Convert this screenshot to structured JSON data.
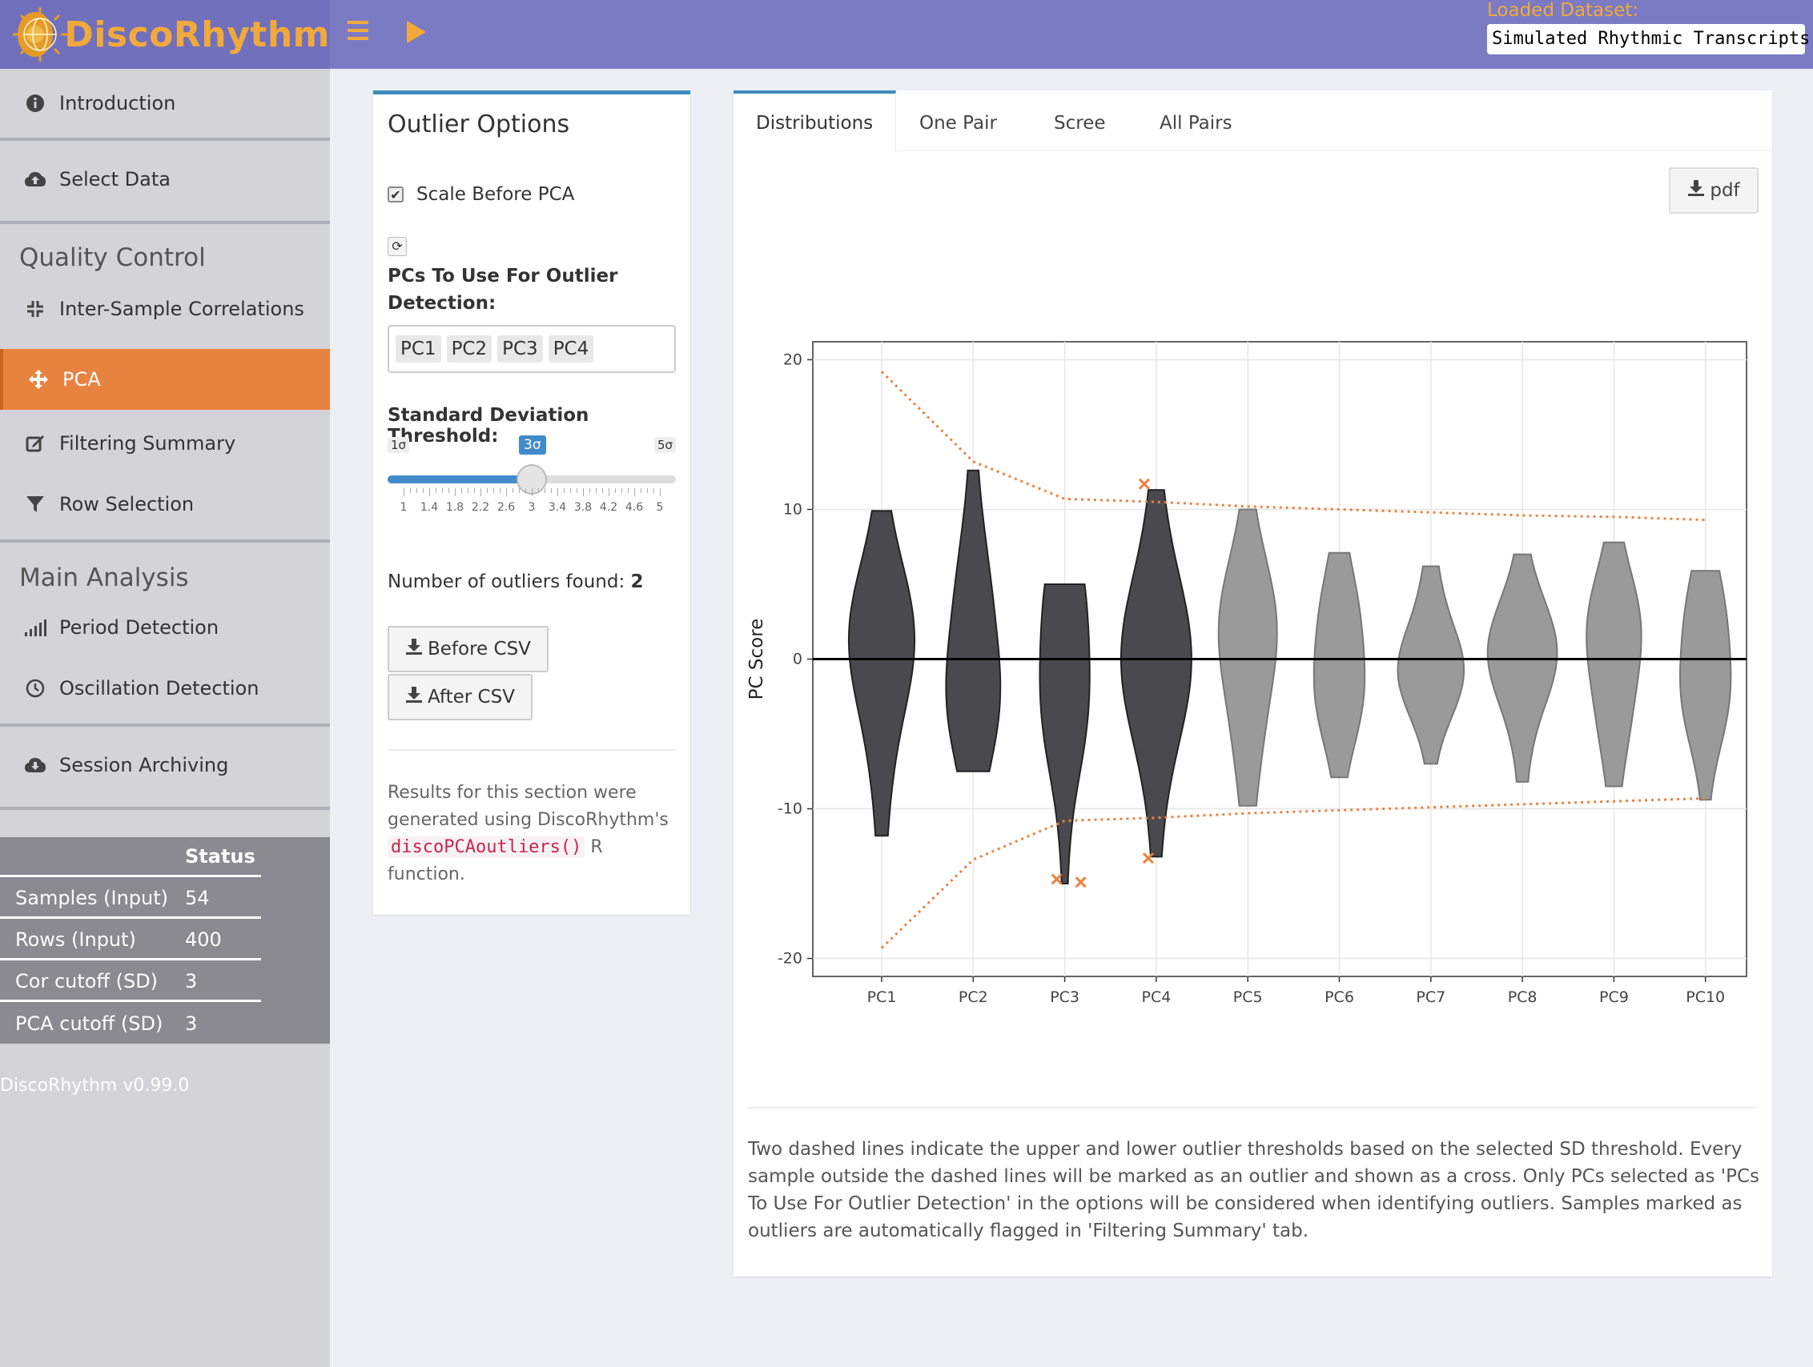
{
  "header": {
    "app_name": "DiscoRhythm",
    "dataset_label": "Loaded Dataset:",
    "dataset_value": "Simulated Rhythmic Transcripts"
  },
  "sidebar": {
    "items": [
      {
        "label": "Introduction",
        "icon": "info-circle-icon"
      },
      {
        "label": "Select Data",
        "icon": "cloud-upload-icon"
      },
      {
        "label": "Inter-Sample Correlations",
        "icon": "compress-icon"
      },
      {
        "label": "PCA",
        "icon": "arrows-move-icon"
      },
      {
        "label": "Filtering Summary",
        "icon": "edit-icon"
      },
      {
        "label": "Row Selection",
        "icon": "filter-icon"
      },
      {
        "label": "Period Detection",
        "icon": "signal-bars-icon"
      },
      {
        "label": "Oscillation Detection",
        "icon": "clock-icon"
      },
      {
        "label": "Session Archiving",
        "icon": "cloud-download-icon"
      }
    ],
    "sections": {
      "quality_control": "Quality Control",
      "main_analysis": "Main Analysis"
    },
    "status_table": {
      "header": "Status",
      "rows": [
        {
          "key": "Samples (Input)",
          "value": "54"
        },
        {
          "key": "Rows (Input)",
          "value": "400"
        },
        {
          "key": "Cor cutoff (SD)",
          "value": "3"
        },
        {
          "key": "PCA cutoff (SD)",
          "value": "3"
        }
      ]
    },
    "version": "DiscoRhythm v0.99.0",
    "active_color": "#e8833f"
  },
  "options": {
    "title": "Outlier Options",
    "scale_label": "Scale Before PCA",
    "scale_checked": true,
    "pcs_label": "PCs To Use For Outlier Detection:",
    "pcs_selected": [
      "PC1",
      "PC2",
      "PC3",
      "PC4"
    ],
    "sd_label": "Standard Deviation Threshold:",
    "sd_min": "1σ",
    "sd_max": "5σ",
    "sd_current": "3σ",
    "sd_value": 3,
    "sd_range": [
      1,
      5
    ],
    "tick_labels": [
      "1",
      "1.4",
      "1.8",
      "2.2",
      "2.6",
      "3",
      "3.4",
      "3.8",
      "4.2",
      "4.6",
      "5"
    ],
    "outliers_label": "Number of outliers found:",
    "outliers_count": "2",
    "before_csv": "Before CSV",
    "after_csv": "After CSV",
    "note_pre": "Results for this section were generated using DiscoRhythm's",
    "note_code": "discoPCAoutliers()",
    "note_post": "R function."
  },
  "plot": {
    "tabs": [
      "Distributions",
      "One Pair",
      "Scree",
      "All Pairs"
    ],
    "active_tab": "Distributions",
    "pdf_label": "pdf",
    "caption": "Two dashed lines indicate the upper and lower outlier thresholds based on the selected SD threshold. Every sample outside the dashed lines will be marked as an outlier and shown as a cross. Only PCs selected as 'PCs To Use For Outlier Detection' in the options will be considered when identifying outliers. Samples marked as outliers are automatically flagged in 'Filtering Summary' tab."
  },
  "chart_data": {
    "type": "violin",
    "ylabel": "PC Score",
    "xlabel": "",
    "ylim": [
      -21.2,
      21.2
    ],
    "yticks": [
      -20,
      -10,
      0,
      10,
      20
    ],
    "categories": [
      "PC1",
      "PC2",
      "PC3",
      "PC4",
      "PC5",
      "PC6",
      "PC7",
      "PC8",
      "PC9",
      "PC10"
    ],
    "selected": [
      true,
      true,
      true,
      true,
      false,
      false,
      false,
      false,
      false,
      false
    ],
    "violin_ranges": [
      {
        "min": -11.8,
        "max": 9.9
      },
      {
        "min": -7.5,
        "max": 12.6
      },
      {
        "min": -15.0,
        "max": 5.0
      },
      {
        "min": -13.2,
        "max": 11.3
      },
      {
        "min": -9.8,
        "max": 10.0
      },
      {
        "min": -7.9,
        "max": 7.1
      },
      {
        "min": -7.0,
        "max": 6.2
      },
      {
        "min": -8.2,
        "max": 7.0
      },
      {
        "min": -8.5,
        "max": 7.8
      },
      {
        "min": -9.4,
        "max": 5.9
      }
    ],
    "upper_threshold": [
      19.2,
      13.2,
      10.7,
      10.5,
      10.2,
      10.0,
      9.8,
      9.6,
      9.5,
      9.3
    ],
    "lower_threshold": [
      -19.3,
      -13.4,
      -10.8,
      -10.6,
      -10.3,
      -10.1,
      -9.9,
      -9.7,
      -9.5,
      -9.3
    ],
    "outliers": [
      {
        "pc": "PC3",
        "y": -14.7,
        "offset": -0.1
      },
      {
        "pc": "PC3",
        "y": -14.9,
        "offset": 0.2
      },
      {
        "pc": "PC4",
        "y": 11.7,
        "offset": -0.15
      },
      {
        "pc": "PC4",
        "y": -13.3,
        "offset": -0.1
      }
    ],
    "colors": {
      "selected": "#4a4a4e",
      "unselected": "#9a9a9a",
      "threshold": "#e8833f"
    },
    "grid": true,
    "legend": "none"
  }
}
